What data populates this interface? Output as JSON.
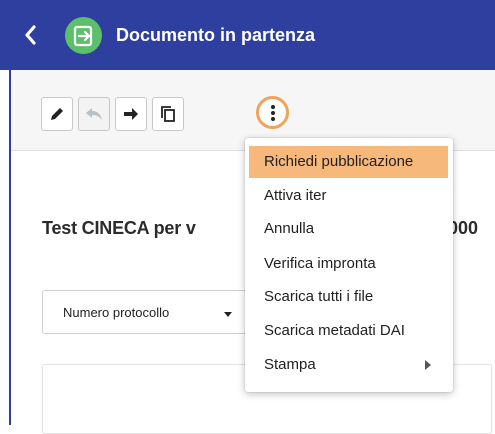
{
  "header": {
    "title": "Documento in partenza",
    "accent_color": "#2e3f9f",
    "app_icon_color": "#5cc06a"
  },
  "toolbar": {
    "buttons": [
      {
        "icon": "pencil-icon",
        "enabled": true
      },
      {
        "icon": "reply-icon",
        "enabled": false
      },
      {
        "icon": "forward-arrow-icon",
        "enabled": true
      },
      {
        "icon": "copy-icon",
        "enabled": true
      },
      {
        "icon": "more-vertical-icon",
        "enabled": true,
        "highlight_color": "#f0a35a"
      }
    ]
  },
  "main": {
    "doc_title_start": "Test CINECA per v",
    "doc_title_end": "000",
    "sort_dropdown": {
      "label": "Numero protocollo"
    }
  },
  "menu": {
    "highlight_color": "#f7b97b",
    "items": [
      {
        "label": "Richiedi pubblicazione",
        "highlighted": true
      },
      {
        "label": "Attiva iter"
      },
      {
        "label": "Annulla"
      },
      {
        "label": "Verifica impronta"
      },
      {
        "label": "Scarica tutti i file"
      },
      {
        "label": "Scarica metadati DAI"
      },
      {
        "label": "Stampa",
        "has_submenu": true
      }
    ]
  }
}
